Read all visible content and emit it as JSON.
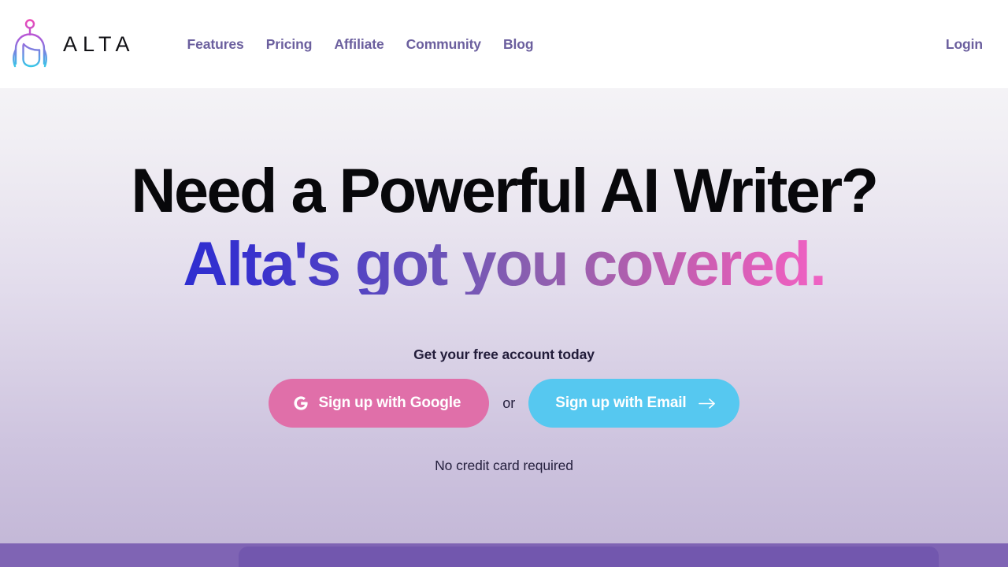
{
  "brand": {
    "name": "ALTA",
    "logo_icon": "alta-avatar-logo-icon",
    "logo_gradient_top": "#e854b4",
    "logo_gradient_bottom": "#35c8e8"
  },
  "nav": {
    "items": [
      {
        "label": "Features"
      },
      {
        "label": "Pricing"
      },
      {
        "label": "Affiliate"
      },
      {
        "label": "Community"
      },
      {
        "label": "Blog"
      }
    ],
    "link_color": "#6b5f9e",
    "login": {
      "label": "Login"
    }
  },
  "hero": {
    "headline_line1": "Need a Powerful AI Writer?",
    "headline_line2": "Alta's got you covered.",
    "headline_line1_color": "#08080b",
    "headline_line2_gradient_start": "#2e2ed0",
    "headline_line2_gradient_end": "#ef63c4",
    "subtitle": "Get your free account today",
    "footnote": "No credit card required",
    "background_gradient_top": "#f4f3f6",
    "background_gradient_bottom": "#c2b6d6"
  },
  "cta": {
    "google_button": {
      "label": "Sign up with Google",
      "icon": "google-g-icon",
      "background": "#e06fa9",
      "text_color": "#ffffff"
    },
    "separator": "or",
    "email_button": {
      "label": "Sign up with Email",
      "icon": "arrow-right-icon",
      "background": "#56c8f0",
      "text_color": "#ffffff"
    }
  },
  "bottom_band": {
    "band_color": "#7f64b4",
    "card_color": "#7257ae"
  }
}
